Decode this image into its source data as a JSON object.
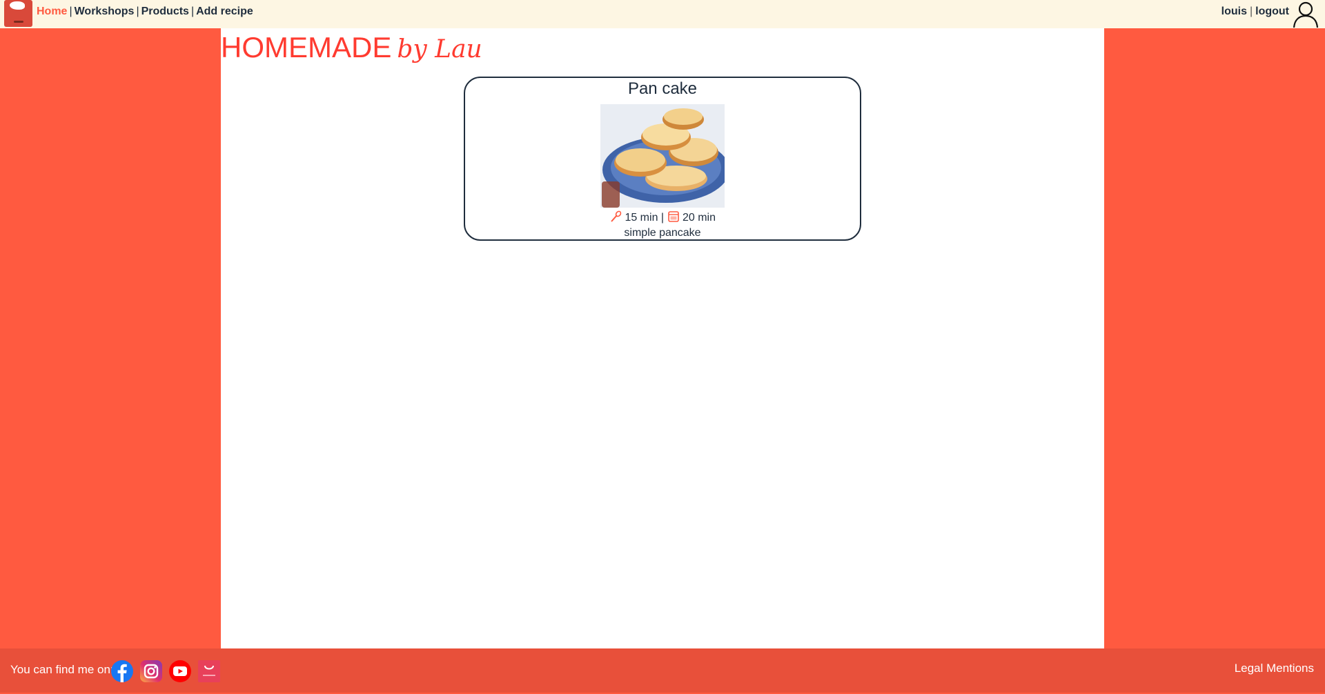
{
  "header": {
    "logo": "homemade-logo",
    "nav": [
      {
        "label": "Home",
        "active": true
      },
      {
        "label": "Workshops",
        "active": false
      },
      {
        "label": "Products",
        "active": false
      },
      {
        "label": "Add recipe",
        "active": false
      }
    ],
    "separator": "|",
    "username": "louis",
    "logout_label": "logout",
    "user_icon": "user-icon"
  },
  "main": {
    "site_title": "HOMEMADE",
    "site_title_suffix": "by Lau",
    "recipes": [
      {
        "title": "Pan cake",
        "image": "pancake-photo",
        "prep_icon": "whisk-icon",
        "prep_time": "15 min",
        "sep": "|",
        "cook_icon": "oven-icon",
        "cook_time": "20 min",
        "description": "simple pancake"
      }
    ]
  },
  "footer": {
    "find_me_label": "You can find me on:",
    "social": [
      "facebook-icon",
      "instagram-icon",
      "youtube-icon",
      "homemade-icon"
    ],
    "legal_label": "Legal Mentions"
  },
  "colors": {
    "accent": "#ff5a40",
    "footer": "#e8503a",
    "topbar": "#fdf6e3",
    "title": "#ff3b30",
    "text": "#1f2d3d"
  }
}
